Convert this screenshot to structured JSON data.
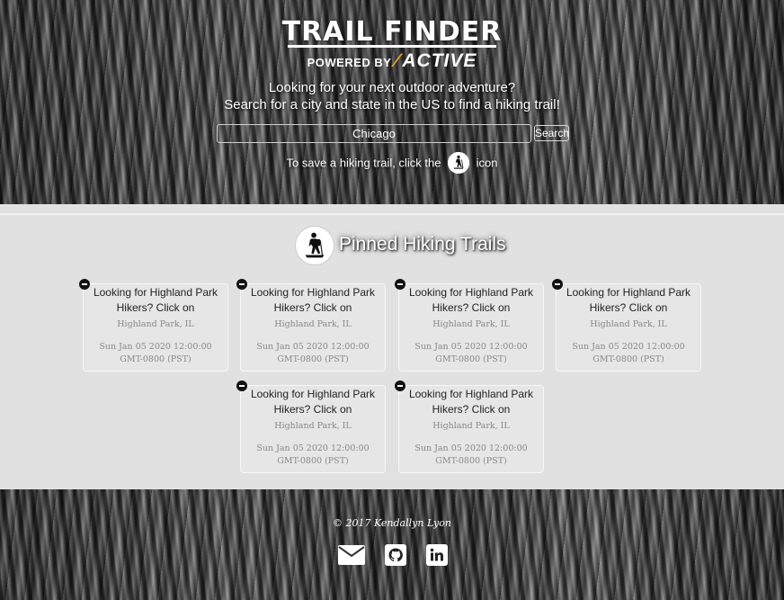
{
  "header": {
    "logo_title": "TRAIL FINDER",
    "powered_by": "POWERED BY",
    "brand": "ACTIVE",
    "tagline_1": "Looking for your next outdoor adventure?",
    "tagline_2": "Search for a city and state in the US to find a hiking trail!",
    "search": {
      "value": "Chicago",
      "button_label": "Search"
    },
    "save_hint_before": "To save a hiking trail, click the",
    "save_hint_after": "icon"
  },
  "pinned": {
    "title": "Pinned Hiking Trails",
    "cards": [
      {
        "name": "Looking for Highland Park Hikers? Click on",
        "location": "Highland Park, IL",
        "date": "Sun Jan 05 2020 12:00:00 GMT-0800 (PST)"
      },
      {
        "name": "Looking for Highland Park Hikers? Click on",
        "location": "Highland Park, IL",
        "date": "Sun Jan 05 2020 12:00:00 GMT-0800 (PST)"
      },
      {
        "name": "Looking for Highland Park Hikers? Click on",
        "location": "Highland Park, IL",
        "date": "Sun Jan 05 2020 12:00:00 GMT-0800 (PST)"
      },
      {
        "name": "Looking for Highland Park Hikers? Click on",
        "location": "Highland Park, IL",
        "date": "Sun Jan 05 2020 12:00:00 GMT-0800 (PST)"
      },
      {
        "name": "Looking for Highland Park Hikers? Click on",
        "location": "Highland Park, IL",
        "date": "Sun Jan 05 2020 12:00:00 GMT-0800 (PST)"
      },
      {
        "name": "Looking for Highland Park Hikers? Click on",
        "location": "Highland Park, IL",
        "date": "Sun Jan 05 2020 12:00:00 GMT-0800 (PST)"
      }
    ]
  },
  "footer": {
    "copyright": "© 2017 Kendallyn Lyon",
    "social": [
      "envelope-icon",
      "github-icon",
      "linkedin-icon"
    ]
  },
  "colors": {
    "accent": "#f2a325",
    "panel": "#e1e1e1",
    "icon": "#111111"
  }
}
